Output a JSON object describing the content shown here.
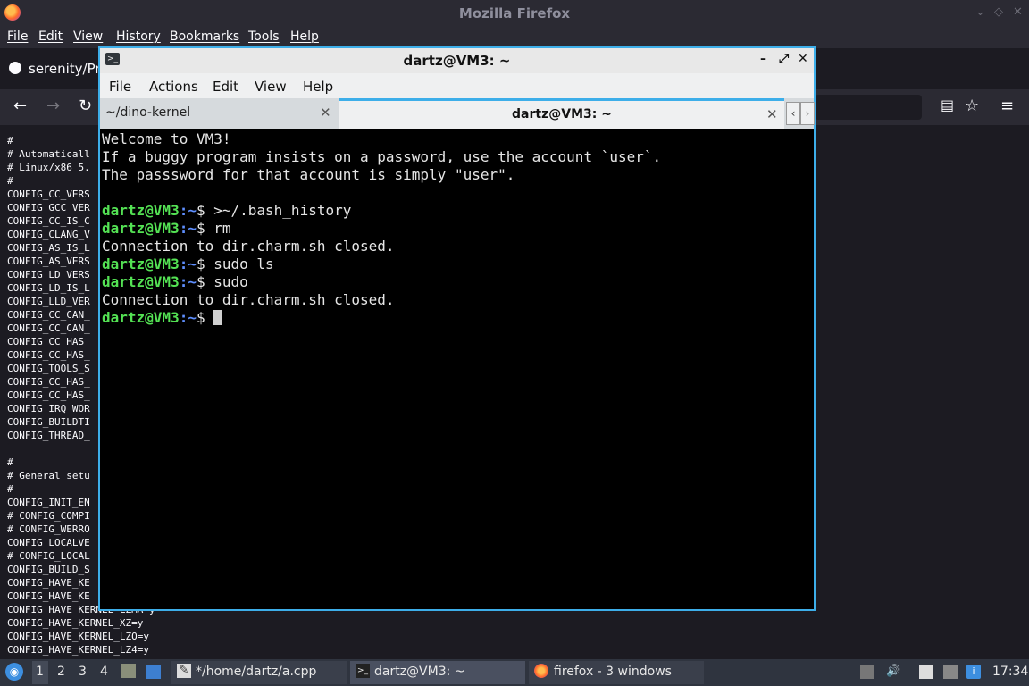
{
  "firefox": {
    "window_title": "Mozilla Firefox",
    "menu": [
      "File",
      "Edit",
      "View",
      "History",
      "Bookmarks",
      "Tools",
      "Help"
    ],
    "tab_title": "serenity/Pro",
    "config_lines": [
      "#",
      "# Automaticall",
      "# Linux/x86 5.",
      "#",
      "CONFIG_CC_VERS",
      "CONFIG_GCC_VER",
      "CONFIG_CC_IS_C",
      "CONFIG_CLANG_V",
      "CONFIG_AS_IS_L",
      "CONFIG_AS_VERS",
      "CONFIG_LD_VERS",
      "CONFIG_LD_IS_L",
      "CONFIG_LLD_VER",
      "CONFIG_CC_CAN_",
      "CONFIG_CC_CAN_",
      "CONFIG_CC_HAS_",
      "CONFIG_CC_HAS_",
      "CONFIG_TOOLS_S",
      "CONFIG_CC_HAS_",
      "CONFIG_CC_HAS_",
      "CONFIG_IRQ_WOR",
      "CONFIG_BUILDTI",
      "CONFIG_THREAD_",
      "",
      "#",
      "# General setu",
      "#",
      "CONFIG_INIT_EN",
      "# CONFIG_COMPI",
      "# CONFIG_WERRO",
      "CONFIG_LOCALVE",
      "# CONFIG_LOCAL",
      "CONFIG_BUILD_S",
      "CONFIG_HAVE_KE",
      "CONFIG_HAVE_KE",
      "CONFIG_HAVE_KERNEL_LZMA=y",
      "CONFIG_HAVE_KERNEL_XZ=y",
      "CONFIG_HAVE_KERNEL_LZO=y",
      "CONFIG_HAVE_KERNEL_LZ4=y"
    ]
  },
  "terminal": {
    "window_title": "dartz@VM3: ~",
    "menu": [
      "File",
      "Actions",
      "Edit",
      "View",
      "Help"
    ],
    "tabs": [
      {
        "label": "~/dino-kernel",
        "active": false
      },
      {
        "label": "dartz@VM3: ~",
        "active": true
      }
    ],
    "prompt_user": "dartz@VM3",
    "prompt_path": ":~",
    "prompt_sym": "$ ",
    "lines": [
      {
        "kind": "text",
        "text": "Welcome to VM3!"
      },
      {
        "kind": "text",
        "text": "If a buggy program insists on a password, use the account `user`."
      },
      {
        "kind": "text",
        "text": "The passsword for that account is simply \"user\"."
      },
      {
        "kind": "text",
        "text": ""
      },
      {
        "kind": "cmd",
        "text": ">~/.bash_history"
      },
      {
        "kind": "cmd",
        "text": "rm"
      },
      {
        "kind": "text",
        "text": "Connection to dir.charm.sh closed."
      },
      {
        "kind": "cmd",
        "text": "sudo ls"
      },
      {
        "kind": "cmd",
        "text": "sudo"
      },
      {
        "kind": "text",
        "text": "Connection to dir.charm.sh closed."
      },
      {
        "kind": "cmd",
        "text": "",
        "cursor": true
      }
    ]
  },
  "taskbar": {
    "workspaces": [
      "1",
      "2",
      "3",
      "4"
    ],
    "tasks": [
      {
        "label": "*/home/dartz/a.cpp"
      },
      {
        "label": "dartz@VM3: ~"
      },
      {
        "label": "firefox - 3 windows"
      }
    ],
    "clock": "17:34"
  }
}
